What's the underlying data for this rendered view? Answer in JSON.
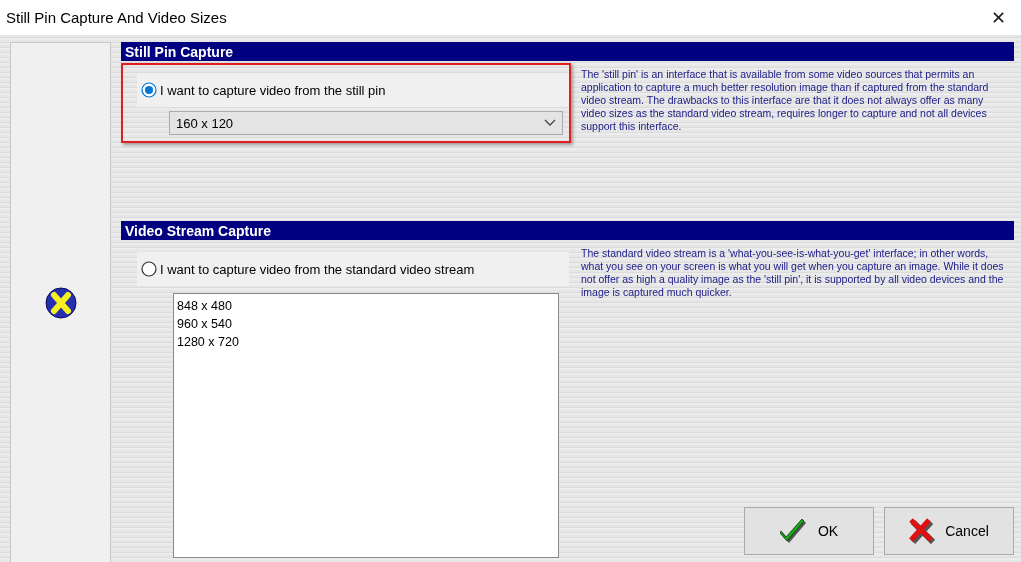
{
  "window": {
    "title": "Still Pin Capture And Video Sizes",
    "close": "✕"
  },
  "sections": [
    {
      "title": "Still Pin Capture",
      "kind": "dropdown",
      "highlighted": true,
      "option": {
        "label": "I want to capture video from the still pin",
        "selected": true
      },
      "value": "160 x 120",
      "description": "The 'still pin' is an interface that is available from some video sources that permits an application to capture a much better resolution image than if captured from the standard video stream.  The drawbacks to this interface are that it does not always offer as many video sizes as the standard video stream, requires longer to capture and not all devices support this interface."
    },
    {
      "title": "Video Stream Capture",
      "kind": "list",
      "highlighted": false,
      "option": {
        "label": "I want to capture video from the standard video stream",
        "selected": false
      },
      "items": [
        "848 x 480",
        "960 x 540",
        "1280 x 720"
      ],
      "description": "The standard video stream is a 'what-you-see-is-what-you-get' interface; in other words, what you see on your screen is what you will get when you capture an image.  While it does not offer as high a quality image as the 'still pin', it is supported by all video devices and the image is captured much quicker."
    }
  ],
  "buttons": [
    {
      "kind": "ok",
      "label": "OK"
    },
    {
      "kind": "cancel",
      "label": "Cancel"
    }
  ]
}
